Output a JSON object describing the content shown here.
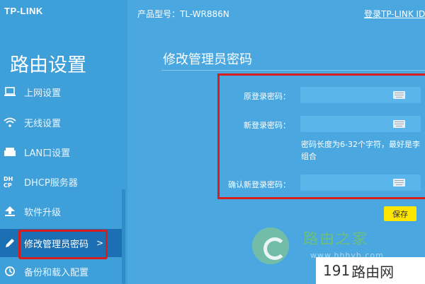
{
  "header": {
    "logo": "TP-LINK",
    "model": "产品型号：TL-WR886N",
    "login_link": "登录TP-LINK ID"
  },
  "sidebar": {
    "title": "路由设置",
    "items": [
      {
        "label": "上网设置",
        "icon": "laptop-icon"
      },
      {
        "label": "无线设置",
        "icon": "wifi-icon"
      },
      {
        "label": "LAN口设置",
        "icon": "lan-port-icon"
      },
      {
        "label": "DHCP服务器",
        "icon": "dhcp-icon"
      },
      {
        "label": "软件升级",
        "icon": "upload-icon"
      },
      {
        "label": "修改管理员密码",
        "icon": "pencil-icon",
        "arrow": ">"
      },
      {
        "label": "备份和载入配置",
        "icon": "backup-icon"
      }
    ]
  },
  "main": {
    "title": "修改管理员密码",
    "fields": [
      {
        "label": "原登录密码：",
        "value": ""
      },
      {
        "label": "新登录密码：",
        "value": ""
      },
      {
        "label": "确认新登录密码：",
        "value": ""
      }
    ],
    "hint": "密码长度为6-32个字符，最好是李组合",
    "save_label": "保存"
  },
  "watermark": {
    "site_name": "路由之家",
    "url": "www.hhhyh.com",
    "badge_num": "191",
    "badge_text": "路由网"
  },
  "colors": {
    "background": "#4aa7df",
    "sidebar": "#3f9fd9",
    "active_nav": "#1c6fb3",
    "highlight_box": "#d81d1d",
    "save_button": "#ffe600"
  }
}
